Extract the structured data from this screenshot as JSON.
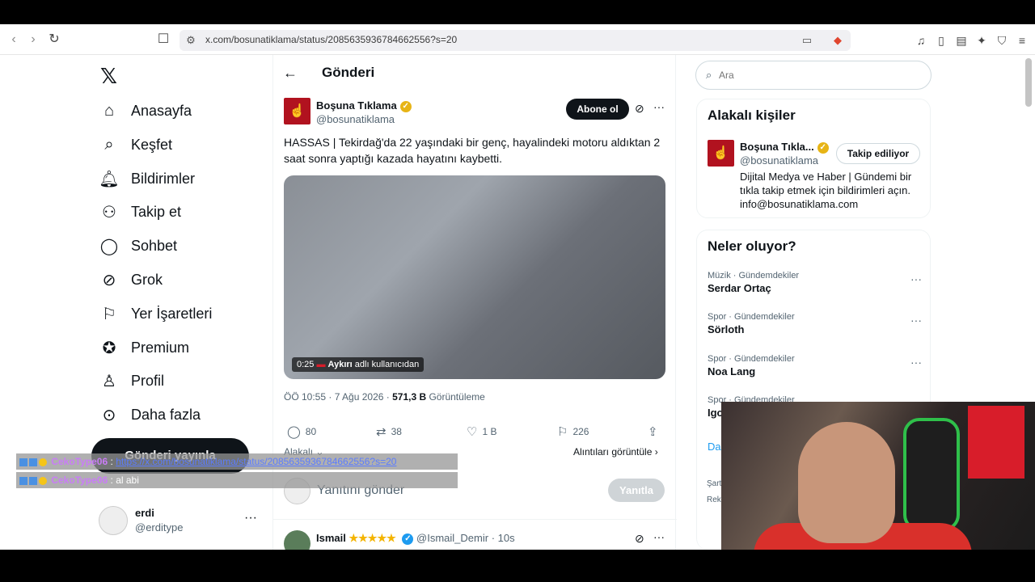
{
  "browser": {
    "url": "x.com/bosunatiklama/status/2085635936784662556?s=20"
  },
  "sidebar": {
    "items": [
      {
        "label": "Anasayfa",
        "icon": "home-icon"
      },
      {
        "label": "Keşfet",
        "icon": "search-icon"
      },
      {
        "label": "Bildirimler",
        "icon": "bell-icon"
      },
      {
        "label": "Takip et",
        "icon": "person-add-icon"
      },
      {
        "label": "Sohbet",
        "icon": "chat-icon"
      },
      {
        "label": "Grok",
        "icon": "grok-icon"
      },
      {
        "label": "Yer İşaretleri",
        "icon": "bookmark-icon"
      },
      {
        "label": "Premium",
        "icon": "verified-icon"
      },
      {
        "label": "Profil",
        "icon": "profile-icon"
      },
      {
        "label": "Daha fazla",
        "icon": "more-circle-icon"
      }
    ],
    "post_button": "Gönderi yayınla",
    "profile": {
      "name": "erdi",
      "handle": "@erditype"
    }
  },
  "chat": [
    {
      "user": "CekoType06",
      "sep": ":",
      "text": "https://x.com/bosunatiklama/status/2085635936784662556?s=20",
      "is_link": true
    },
    {
      "user": "CekoType06",
      "sep": ":",
      "text": "al abi",
      "is_link": false
    }
  ],
  "main": {
    "header_title": "Gönderi",
    "tweet": {
      "name": "Boşuna Tıklama",
      "handle": "@bosunatiklama",
      "subscribe": "Abone ol",
      "text": "HASSAS | Tekirdağ'da 22 yaşındaki bir genç, hayalindeki motoru aldıktan 2 saat sonra yaptığı kazada hayatını kaybetti.",
      "media": {
        "duration": "0:25",
        "source_user": "Aykırı",
        "source_suffix": "adlı kullanıcıdan"
      },
      "time": "ÖÖ 10:55 · 7 Ağu 2026 · ",
      "views": "571,3 B",
      "views_label": " Görüntüleme",
      "replies": "80",
      "reposts": "38",
      "likes": "1 B",
      "bookmarks": "226"
    },
    "relevant": "Alakalı",
    "quotes": "Alıntıları görüntüle",
    "reply_placeholder": "Yanıtını gönder",
    "reply_button": "Yanıtla",
    "reply2": {
      "name": "Ismail",
      "stars": "★★★★★",
      "handle": "@Ismail_Demir",
      "time": "· 10s"
    }
  },
  "right": {
    "search_placeholder": "Ara",
    "people_title": "Alakalı kişiler",
    "person": {
      "name": "Boşuna Tıkla...",
      "handle": "@bosunatiklama",
      "follow": "Takip ediliyor",
      "bio": "Dijital Medya ve Haber | Gündemi bir tıkla takip etmek için bildirimleri açın. info@bosunatiklama.com"
    },
    "trends_title": "Neler oluyor?",
    "trends": [
      {
        "category": "Müzik · Gündemdekiler",
        "name": "Serdar Ortaç"
      },
      {
        "category": "Spor · Gündemdekiler",
        "name": "Sörloth"
      },
      {
        "category": "Spor · Gündemdekiler",
        "name": "Noa Lang"
      },
      {
        "category": "Spor · Gündemdekiler",
        "name": "Igo"
      }
    ],
    "show_more": "Da",
    "footer1": "Şart",
    "footer2": "Rekl"
  }
}
